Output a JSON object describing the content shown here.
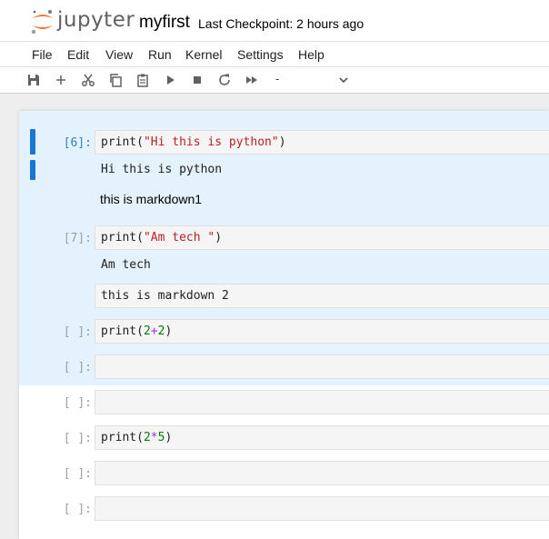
{
  "header": {
    "logo_text": "jupyter",
    "notebook_title": "myfirst",
    "checkpoint": "Last Checkpoint: 2 hours ago"
  },
  "menu": [
    "File",
    "Edit",
    "View",
    "Run",
    "Kernel",
    "Settings",
    "Help"
  ],
  "toolbar": {
    "icons": [
      "save-icon",
      "add-cell-icon",
      "cut-icon",
      "copy-icon",
      "paste-icon",
      "run-icon",
      "stop-icon",
      "restart-icon",
      "run-all-icon"
    ],
    "cell_type": "-"
  },
  "cells": [
    {
      "prompt": "[6]:",
      "code": {
        "fn": "print(",
        "arg": "\"Hi this is python\"",
        "close": ")"
      },
      "output": "Hi this is python"
    },
    {
      "markdown": "this is markdown1"
    },
    {
      "prompt": "[7]:",
      "code": {
        "fn": "print(",
        "arg": "\"Am tech \"",
        "close": ")"
      },
      "output": "Am tech"
    },
    {
      "markdown_source": "this is markdown 2"
    },
    {
      "prompt": "[ ]:",
      "code": {
        "fn": "print(",
        "a": "2",
        "op": "+",
        "b": "2",
        "close": ")"
      }
    },
    {
      "prompt": "[ ]:",
      "code": ""
    },
    {
      "prompt": "[ ]:",
      "code": ""
    },
    {
      "prompt": "[ ]:",
      "code": {
        "fn": "print(",
        "a": "2",
        "op": "*",
        "b": "5",
        "close": ")"
      }
    },
    {
      "prompt": "[ ]:",
      "code": ""
    },
    {
      "prompt": "[ ]:",
      "code": ""
    }
  ],
  "colors": {
    "brand_orange": "#f37626",
    "selection_bg": "#e3f2fd",
    "collapser": "#1976d2",
    "active_prompt": "#307fc1",
    "string": "#ba2121",
    "number": "#008000",
    "operator": "#aa22ff"
  }
}
